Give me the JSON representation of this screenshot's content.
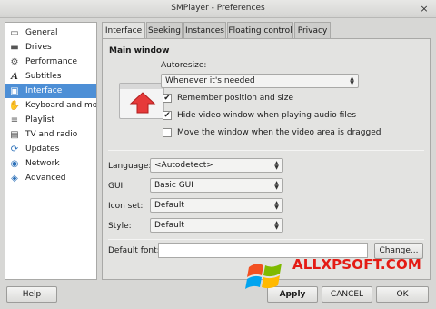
{
  "window": {
    "title": "SMPlayer - Preferences",
    "close_glyph": "×"
  },
  "sidebar": {
    "items": [
      {
        "label": "General",
        "icon": "general-icon",
        "glyph": "▭",
        "color": "#555555"
      },
      {
        "label": "Drives",
        "icon": "drive-icon",
        "glyph": "▬",
        "color": "#555555"
      },
      {
        "label": "Performance",
        "icon": "performance-icon",
        "glyph": "⚙",
        "color": "#555555"
      },
      {
        "label": "Subtitles",
        "icon": "subtitles-icon",
        "glyph": "A",
        "color": "#222222"
      },
      {
        "label": "Interface",
        "icon": "interface-icon",
        "glyph": "▣",
        "color": "#ffffff",
        "selected": true
      },
      {
        "label": "Keyboard and mous",
        "icon": "keyboard-icon",
        "glyph": "✋",
        "color": "#444444"
      },
      {
        "label": "Playlist",
        "icon": "playlist-icon",
        "glyph": "≡",
        "color": "#555555"
      },
      {
        "label": "TV and radio",
        "icon": "tv-icon",
        "glyph": "▤",
        "color": "#444444"
      },
      {
        "label": "Updates",
        "icon": "updates-icon",
        "glyph": "⟳",
        "color": "#2a6fb8"
      },
      {
        "label": "Network",
        "icon": "network-icon",
        "glyph": "◉",
        "color": "#2a6fb8"
      },
      {
        "label": "Advanced",
        "icon": "advanced-icon",
        "glyph": "◈",
        "color": "#2a6fb8"
      }
    ]
  },
  "tabs": [
    {
      "label": "Interface",
      "active": true
    },
    {
      "label": "Seeking"
    },
    {
      "label": "Instances"
    },
    {
      "label": "Floating control"
    },
    {
      "label": "Privacy"
    }
  ],
  "main_window": {
    "group_title": "Main window",
    "autoresize_label": "Autoresize:",
    "autoresize_value": "Whenever it's needed",
    "remember_label": "Remember position and size",
    "remember_checked": true,
    "hide_video_label": "Hide video window when playing audio files",
    "hide_video_checked": true,
    "move_window_label": "Move the window when the video area is dragged",
    "move_window_checked": false
  },
  "form": {
    "language_label": "Language:",
    "language_value": "<Autodetect>",
    "gui_label": "GUI",
    "gui_value": "Basic GUI",
    "iconset_label": "Icon set:",
    "iconset_value": "Default",
    "style_label": "Style:",
    "style_value": "Default",
    "font_label": "Default font:",
    "font_value": "",
    "change_button": "Change..."
  },
  "buttons": {
    "help": "Help",
    "apply": "Apply",
    "cancel": "CANCEL",
    "ok": "OK"
  },
  "check_glyph": "✔",
  "combo_arrows": "▲▼",
  "watermark": {
    "text": "ALLXPSOFT.COM",
    "color": "#e41b14"
  }
}
